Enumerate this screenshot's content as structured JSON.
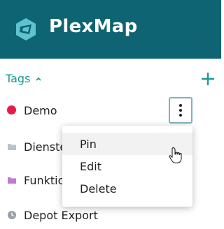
{
  "header": {
    "app_title": "PlexMap",
    "logo_icon": "plexmap-logo-icon",
    "background": "#0f6473"
  },
  "tags": {
    "heading": "Tags",
    "caret_icon": "chevron-up-icon",
    "add_icon": "plus-icon",
    "accent": "#1a9a8f",
    "items": [
      {
        "label": "Demo",
        "icon": "red-dot-icon",
        "color": "#e8194b"
      },
      {
        "label": "Dienste",
        "icon": "folder-icon",
        "color": "#b8c3ca"
      },
      {
        "label": "Funktio",
        "icon": "folder-icon",
        "color": "#c07ad6"
      },
      {
        "label": "Depot Export",
        "icon": "clock-icon",
        "color": "#9aa0a6"
      }
    ]
  },
  "context_menu": {
    "items": [
      {
        "label": "Pin"
      },
      {
        "label": "Edit"
      },
      {
        "label": "Delete"
      }
    ],
    "trigger_icon": "more-vertical-icon"
  }
}
